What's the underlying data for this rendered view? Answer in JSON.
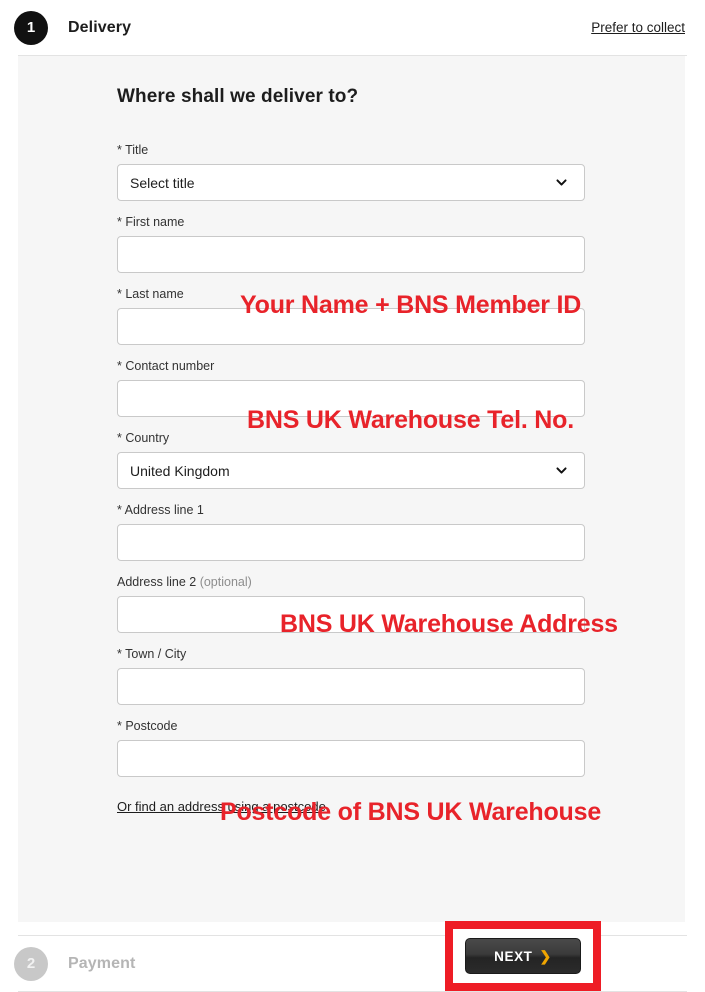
{
  "steps": {
    "delivery": {
      "number": "1",
      "title": "Delivery",
      "collect_link": "Prefer to collect"
    },
    "payment": {
      "number": "2",
      "title": "Payment"
    }
  },
  "form": {
    "heading": "Where shall we deliver to?",
    "fields": {
      "title": {
        "label": "* Title",
        "value": "Select title"
      },
      "first_name": {
        "label": "* First name",
        "value": ""
      },
      "last_name": {
        "label": "* Last name",
        "value": ""
      },
      "contact_number": {
        "label": "* Contact number",
        "value": ""
      },
      "country": {
        "label": "* Country",
        "value": "United Kingdom"
      },
      "address_line_1": {
        "label": "* Address line 1",
        "value": ""
      },
      "address_line_2": {
        "label": "Address line 2 ",
        "optional_suffix": "(optional)",
        "value": ""
      },
      "town_city": {
        "label": "* Town / City",
        "value": ""
      },
      "postcode": {
        "label": "* Postcode",
        "value": ""
      }
    },
    "postcode_lookup_link": "Or find an address using a postcode",
    "next_button": {
      "label": "NEXT",
      "arrow": "❯"
    }
  },
  "annotations": {
    "name": "Your Name + BNS Member ID",
    "telephone": "BNS UK Warehouse Tel. No.",
    "address": "BNS UK Warehouse Address",
    "postcode": "Postcode of BNS UK Warehouse"
  },
  "colors": {
    "annotation_red": "#e8232a",
    "highlight_red": "#ee1c25",
    "next_arrow_gold": "#f0a500",
    "panel_background": "#f6f6f6"
  }
}
